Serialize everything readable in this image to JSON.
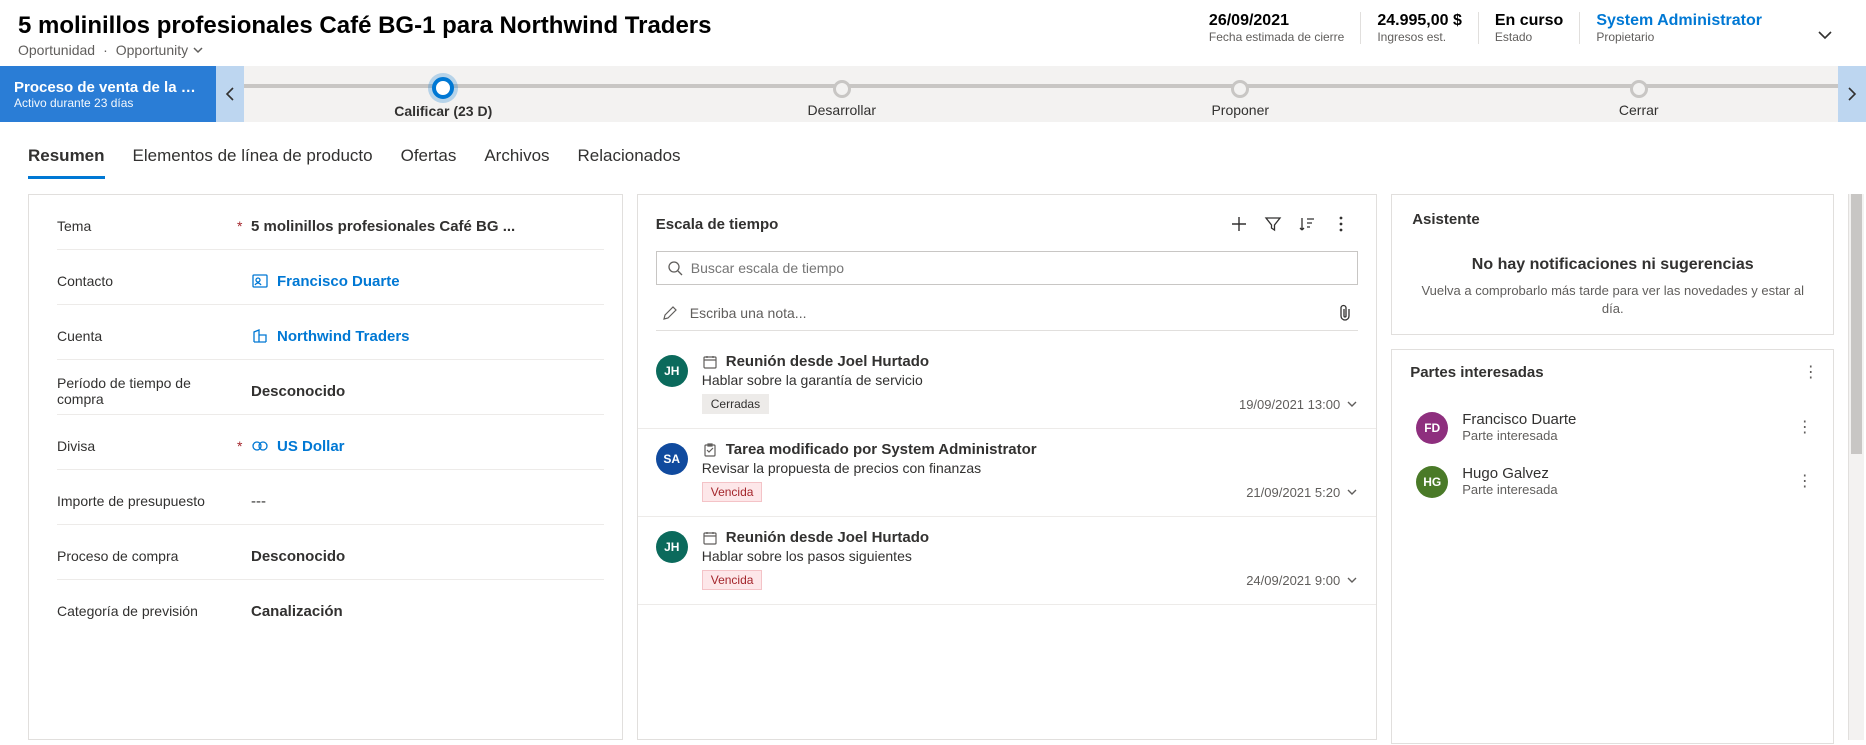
{
  "header": {
    "title": "5 molinillos profesionales Café BG-1 para Northwind Traders",
    "entity": "Oportunidad",
    "form": "Opportunity",
    "metrics": [
      {
        "value": "26/09/2021",
        "label": "Fecha estimada de cierre"
      },
      {
        "value": "24.995,00 $",
        "label": "Ingresos est."
      },
      {
        "value": "En curso",
        "label": "Estado"
      },
      {
        "value": "System Administrator",
        "label": "Propietario",
        "link": true
      }
    ]
  },
  "process": {
    "name": "Proceso de venta de la o...",
    "sub": "Activo durante 23 días",
    "stages": [
      {
        "label": "Calificar  (23 D)",
        "active": true
      },
      {
        "label": "Desarrollar"
      },
      {
        "label": "Proponer"
      },
      {
        "label": "Cerrar"
      }
    ]
  },
  "tabs": [
    "Resumen",
    "Elementos de línea de producto",
    "Ofertas",
    "Archivos",
    "Relacionados"
  ],
  "activeTab": 0,
  "fields": [
    {
      "label": "Tema",
      "required": true,
      "value": "5 molinillos profesionales Café BG ...",
      "type": "text"
    },
    {
      "label": "Contacto",
      "required": false,
      "value": "Francisco Duarte",
      "type": "contact"
    },
    {
      "label": "Cuenta",
      "required": false,
      "value": "Northwind Traders",
      "type": "account"
    },
    {
      "label": "Período de tiempo de compra",
      "required": false,
      "value": "Desconocido",
      "type": "plain"
    },
    {
      "label": "Divisa",
      "required": true,
      "value": "US Dollar",
      "type": "currency"
    },
    {
      "label": "Importe de presupuesto",
      "required": false,
      "value": "---",
      "type": "plaintext"
    },
    {
      "label": "Proceso de compra",
      "required": false,
      "value": "Desconocido",
      "type": "plain"
    },
    {
      "label": "Categoría de previsión",
      "required": false,
      "value": "Canalización",
      "type": "plain"
    }
  ],
  "timeline": {
    "title": "Escala de tiempo",
    "search_placeholder": "Buscar escala de tiempo",
    "note_placeholder": "Escriba una nota...",
    "items": [
      {
        "avatar": "JH",
        "avatarClass": "jh",
        "icon": "calendar",
        "title": "Reunión desde Joel Hurtado",
        "sub": "Hablar sobre la garantía de servicio",
        "badge": "Cerradas",
        "badgeClass": "closed",
        "date": "19/09/2021 13:00"
      },
      {
        "avatar": "SA",
        "avatarClass": "sa",
        "icon": "task",
        "title": "Tarea modificado por System Administrator",
        "sub": "Revisar la propuesta de precios con finanzas",
        "badge": "Vencida",
        "badgeClass": "overdue",
        "date": "21/09/2021 5:20"
      },
      {
        "avatar": "JH",
        "avatarClass": "jh",
        "icon": "calendar",
        "title": "Reunión desde Joel Hurtado",
        "sub": "Hablar sobre los pasos siguientes",
        "badge": "Vencida",
        "badgeClass": "overdue",
        "date": "24/09/2021 9:00"
      }
    ]
  },
  "assistant": {
    "title": "Asistente",
    "empty_heading": "No hay notificaciones ni sugerencias",
    "empty_sub": "Vuelva a comprobarlo más tarde para ver las novedades y estar al día."
  },
  "stakeholders": {
    "title": "Partes interesadas",
    "items": [
      {
        "initials": "FD",
        "cls": "fd",
        "name": "Francisco Duarte",
        "role": "Parte interesada"
      },
      {
        "initials": "HG",
        "cls": "hg",
        "name": "Hugo Galvez",
        "role": "Parte interesada"
      }
    ]
  }
}
